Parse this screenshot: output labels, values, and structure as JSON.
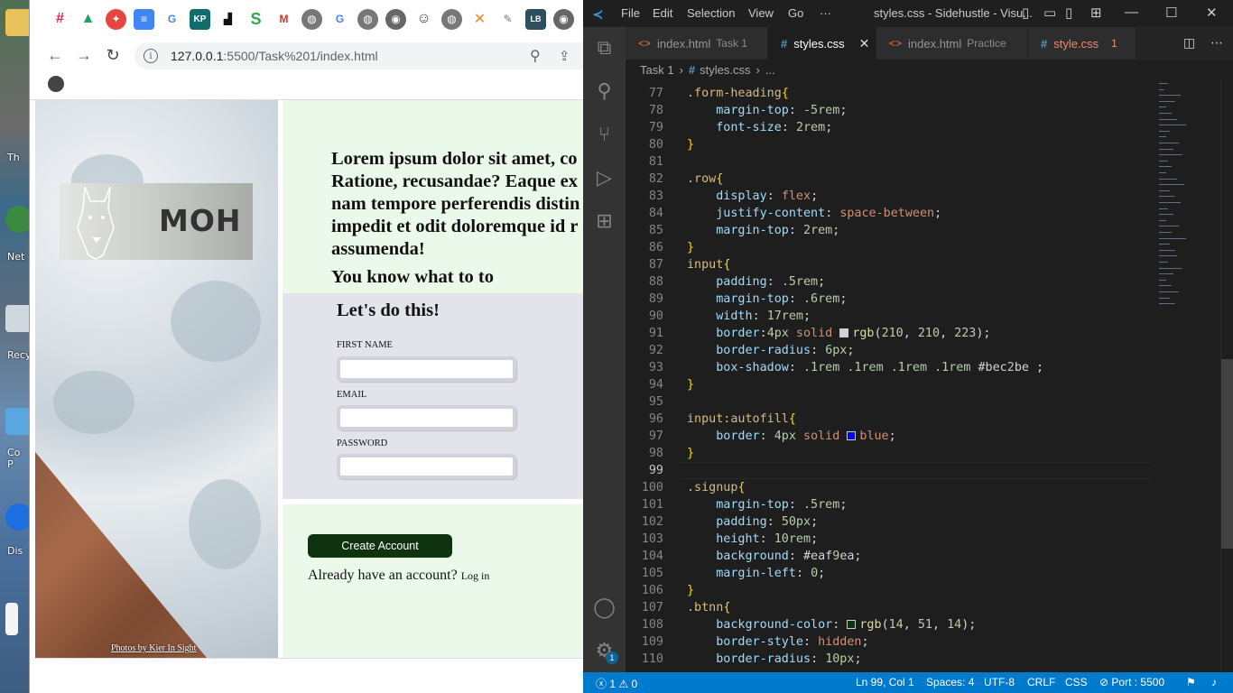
{
  "desktop": {
    "labels": [
      "Th",
      "Net",
      "Recy",
      "Co P",
      "Dis"
    ]
  },
  "browser": {
    "url_host": "127.0.0.1",
    "url_rest": ":5500/Task%201/index.html",
    "info_glyph": "i",
    "bookmark_icons": [
      "slack-icon",
      "drive-icon",
      "compass-icon",
      "docs-icon",
      "google-icon",
      "kp-icon",
      "bookmark-icon",
      "s-icon",
      "gmail-icon",
      "globe-icon",
      "google-icon",
      "globe-icon",
      "chrome-icon",
      "smiley-icon",
      "x-icon",
      "puzzle-icon",
      "lb-icon",
      "chrome-icon"
    ]
  },
  "webpage": {
    "logo_text": "MOH",
    "intro_lines": [
      "Lorem ipsum dolor sit amet, co",
      "Ratione, recusandae? Eaque ex",
      "nam tempore perferendis distin",
      "impedit et odit doloremque id r",
      "assumenda!"
    ],
    "intro_sub": "You know what to to",
    "form_heading": "Let's do this!",
    "labels": {
      "first_name": "FIRST NAME",
      "email": "EMAIL",
      "password": "PASSWORD"
    },
    "create_button": "Create Account",
    "already_text": "Already have an account?",
    "login_link": "Log in",
    "photo_credit": "Photos by Kier In Sight"
  },
  "vscode": {
    "menu": [
      "File",
      "Edit",
      "Selection",
      "View",
      "Go",
      "···"
    ],
    "window_title": "styles.css - Sidehustle - Visu...",
    "tabs": [
      {
        "name": "index.html",
        "desc": "Task 1",
        "kind": "html"
      },
      {
        "name": "styles.css",
        "desc": "",
        "kind": "css"
      },
      {
        "name": "index.html",
        "desc": "Practice",
        "kind": "html"
      },
      {
        "name": "style.css",
        "desc": "1",
        "kind": "css"
      }
    ],
    "breadcrumb": [
      "Task 1",
      "styles.css",
      "..."
    ],
    "status": {
      "errors": "1",
      "warnings": "0",
      "position": "Ln 99, Col 1",
      "spaces": "Spaces: 4",
      "encoding": "UTF-8",
      "eol": "CRLF",
      "language": "CSS",
      "port": "Port : 5500"
    },
    "activity_badge": "1",
    "colors": {
      "accent": "#007acc",
      "swatch_input_border": "#d2d2df",
      "swatch_shadow": "#bec2be",
      "swatch_blue": "#0000ff",
      "swatch_signup": "#eaf9ea",
      "swatch_btn": "#0e330e"
    },
    "code_lines": [
      {
        "n": "77",
        "text": ".form-heading{"
      },
      {
        "n": "78",
        "text": "    margin-top: -5rem;"
      },
      {
        "n": "79",
        "text": "    font-size: 2rem;"
      },
      {
        "n": "80",
        "text": "}"
      },
      {
        "n": "81",
        "text": ""
      },
      {
        "n": "82",
        "text": ".row{"
      },
      {
        "n": "83",
        "text": "    display: flex;"
      },
      {
        "n": "84",
        "text": "    justify-content: space-between;"
      },
      {
        "n": "85",
        "text": "    margin-top: 2rem;"
      },
      {
        "n": "86",
        "text": "}"
      },
      {
        "n": "87",
        "text": "input{"
      },
      {
        "n": "88",
        "text": "    padding: .5rem;"
      },
      {
        "n": "89",
        "text": "    margin-top: .6rem;"
      },
      {
        "n": "90",
        "text": "    width: 17rem;"
      },
      {
        "n": "91",
        "text": "    border:4px solid rgb(210, 210, 223);"
      },
      {
        "n": "92",
        "text": "    border-radius: 6px;"
      },
      {
        "n": "93",
        "text": "    box-shadow: .1rem .1rem .1rem .1rem #bec2be ;"
      },
      {
        "n": "94",
        "text": "}"
      },
      {
        "n": "95",
        "text": ""
      },
      {
        "n": "96",
        "text": "input:autofill{"
      },
      {
        "n": "97",
        "text": "    border: 4px solid blue;"
      },
      {
        "n": "98",
        "text": "}"
      },
      {
        "n": "99",
        "text": ""
      },
      {
        "n": "100",
        "text": ".signup{"
      },
      {
        "n": "101",
        "text": "    margin-top: .5rem;"
      },
      {
        "n": "102",
        "text": "    padding: 50px;"
      },
      {
        "n": "103",
        "text": "    height: 10rem;"
      },
      {
        "n": "104",
        "text": "    background: #eaf9ea;"
      },
      {
        "n": "105",
        "text": "    margin-left: 0;"
      },
      {
        "n": "106",
        "text": "}"
      },
      {
        "n": "107",
        "text": ".btnn{"
      },
      {
        "n": "108",
        "text": "    background-color: rgb(14, 51, 14);"
      },
      {
        "n": "109",
        "text": "    border-style: hidden;"
      },
      {
        "n": "110",
        "text": "    border-radius: 10px;"
      }
    ]
  }
}
